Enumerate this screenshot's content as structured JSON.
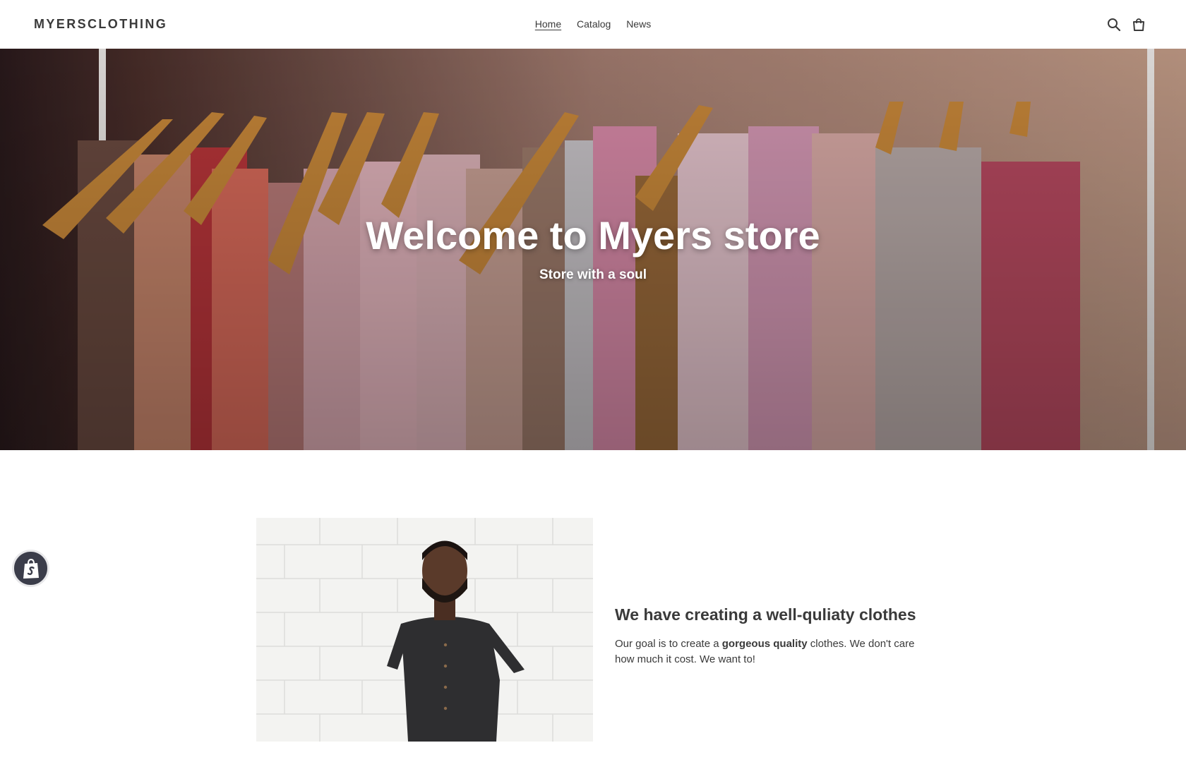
{
  "header": {
    "logo": "MYERSCLOTHING",
    "nav": [
      {
        "label": "Home",
        "active": true
      },
      {
        "label": "Catalog",
        "active": false
      },
      {
        "label": "News",
        "active": false
      }
    ],
    "icons": [
      "search-icon",
      "cart-icon"
    ]
  },
  "hero": {
    "title": "Welcome to Myers store",
    "subtitle": "Store with a soul"
  },
  "feature": {
    "heading": "We have creating a well-quliaty clothes",
    "text_before": "Our goal is to create a ",
    "text_bold": "gorgeous quality",
    "text_after": " clothes. We don't care how much it cost. We want to!"
  },
  "badge": {
    "icon": "shopify-bag-icon"
  },
  "colors": {
    "text": "#3a3a3a",
    "hero_text": "#ffffff",
    "badge_bg": "#3b3d4a"
  }
}
